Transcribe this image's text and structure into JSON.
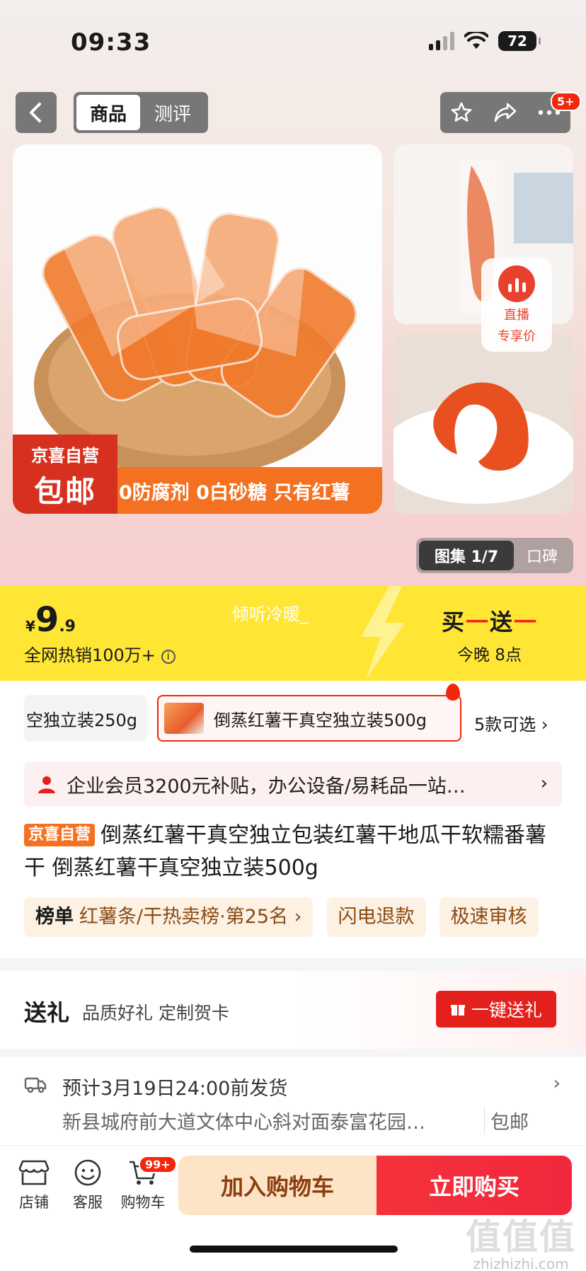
{
  "status_bar": {
    "time": "09:33",
    "battery": "72"
  },
  "nav": {
    "tab_product": "商品",
    "tab_review": "测评",
    "more_badge": "5+"
  },
  "images": {
    "live_line1": "直播",
    "live_line2": "专享价",
    "promo_brand": "京喜自营",
    "promo_shipping": "包邮",
    "promo_slogan": "0防腐剂 0白砂糖 只有红薯",
    "gallery_label": "图集 1/7",
    "reputation_label": "口碑"
  },
  "price_band": {
    "currency": "¥",
    "price_int": "9",
    "price_dec": ".9",
    "hot_sales": "全网热销100万+",
    "nickname": "倾听冷暖_",
    "bogo_1": "买",
    "bogo_dash": "一",
    "bogo_2": "送",
    "tonight": "今晚 8点"
  },
  "sku": {
    "left_option": "空独立装250g",
    "selected_option": "倒蒸红薯干真空独立装500g",
    "more_options": "5款可选"
  },
  "enterprise_banner": "企业会员3200元补贴，办公设备/易耗品一站…",
  "product": {
    "tag": "京喜自营",
    "title": "倒蒸红薯干真空独立包装红薯干地瓜干软糯番薯干 倒蒸红薯干真空独立装500g"
  },
  "chips": {
    "rank_label": "榜单",
    "rank_text": "红薯条/干热卖榜·第25名",
    "chip2": "闪电退款",
    "chip3": "极速审核"
  },
  "gift": {
    "title": "送礼",
    "subtitle": "品质好礼 定制贺卡",
    "button": "一键送礼"
  },
  "shipping": {
    "estimate": "预计3月19日24:00前发货",
    "address": "新县城府前大道文体中心斜对面泰富花园…",
    "free_shipping": "包邮"
  },
  "bottom_bar": {
    "store": "店铺",
    "service": "客服",
    "cart": "购物车",
    "cart_badge": "99+",
    "add_to_cart": "加入购物车",
    "buy_now": "立即购买"
  },
  "watermark": {
    "logo": "值值值",
    "site": "zhizhizhi.com"
  },
  "colors": {
    "accent_red": "#f2270c",
    "price_band": "#ffe635",
    "promo_orange": "#f37120"
  }
}
